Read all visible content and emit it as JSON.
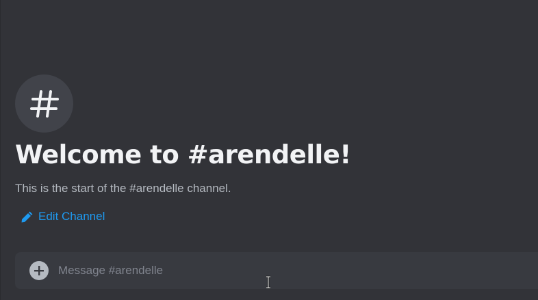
{
  "channel": {
    "icon": "hashtag-icon",
    "welcome_title": "Welcome to #arendelle!",
    "welcome_description": "This is the start of the #arendelle channel.",
    "edit_label": "Edit Channel",
    "edit_icon": "pencil-icon"
  },
  "composer": {
    "attach_icon": "plus-circle-icon",
    "placeholder": "Message #arendelle",
    "value": ""
  },
  "colors": {
    "background": "#323338",
    "accent_link": "#1e9af0",
    "title": "#f2f3f5",
    "muted_text": "#b5bac1",
    "composer_bg": "#383a40",
    "icon_circle_bg": "#41434a"
  }
}
